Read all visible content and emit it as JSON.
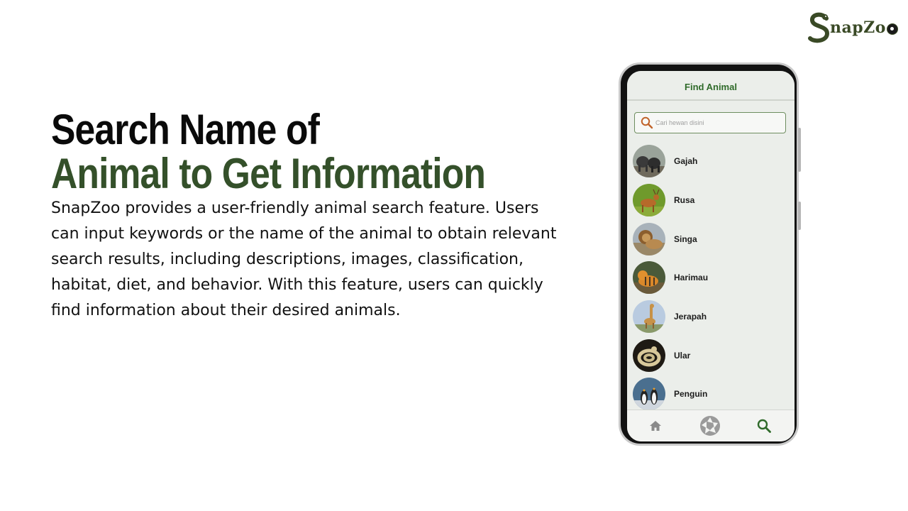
{
  "brand": {
    "name": "SnapZoo",
    "logo_initial": "S",
    "logo_rest": "napZo"
  },
  "heading": {
    "line1": "Search Name of",
    "line2": "Animal to Get Information"
  },
  "description": "SnapZoo provides a user-friendly animal search feature. Users can input keywords or the name of the animal to obtain relevant search results, including descriptions, images, classification, habitat, diet, and behavior. With this feature, users can quickly find information about their desired animals.",
  "colors": {
    "brand_green": "#34502a",
    "app_green": "#2f6a2a",
    "search_icon": "#c0632a"
  },
  "app": {
    "title": "Find Animal",
    "search": {
      "placeholder": "Cari hewan disini",
      "value": "",
      "icon": "search-icon"
    },
    "animals": [
      {
        "name": "Gajah"
      },
      {
        "name": "Rusa"
      },
      {
        "name": "Singa"
      },
      {
        "name": "Harimau"
      },
      {
        "name": "Jerapah"
      },
      {
        "name": "Ular"
      },
      {
        "name": "Penguin"
      }
    ],
    "nav": [
      {
        "icon": "home-icon",
        "active": false
      },
      {
        "icon": "camera-shutter-icon",
        "active": false
      },
      {
        "icon": "search-icon",
        "active": true
      }
    ]
  }
}
